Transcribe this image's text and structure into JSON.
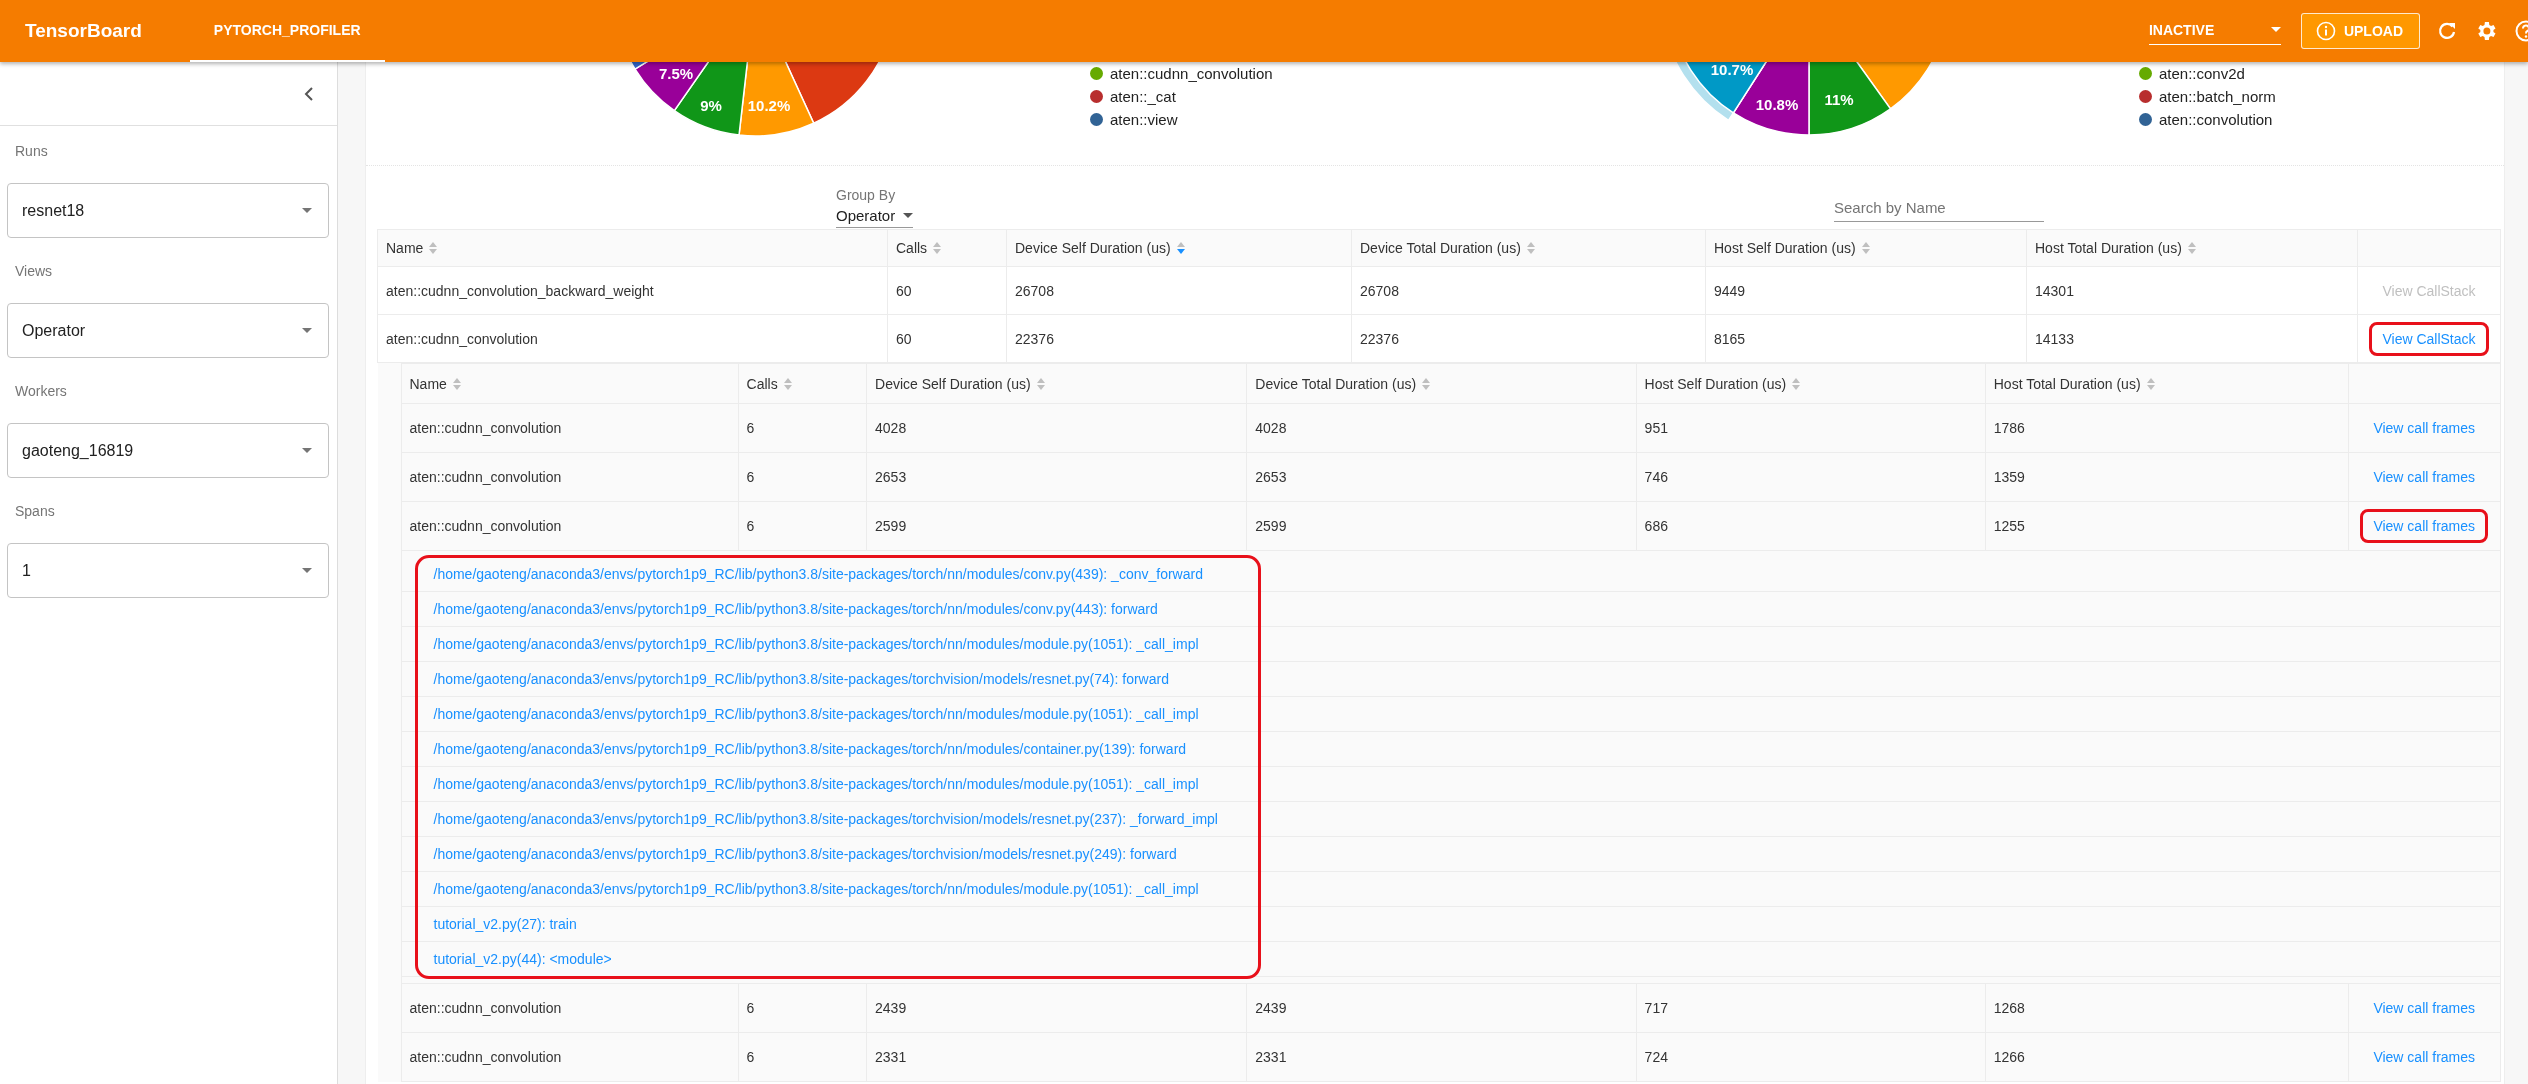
{
  "header": {
    "title": "TensorBoard",
    "tabs": [
      {
        "label": "PYTORCH_PROFILER",
        "selected": true
      }
    ],
    "status_select": {
      "value": "INACTIVE"
    },
    "upload_button": {
      "label": "UPLOAD"
    }
  },
  "sidebar": {
    "fields": [
      {
        "label": "Runs",
        "value": "resnet18"
      },
      {
        "label": "Views",
        "value": "Operator"
      },
      {
        "label": "Workers",
        "value": "gaoteng_16819"
      },
      {
        "label": "Spans",
        "value": "1"
      }
    ]
  },
  "pie_charts": [
    {
      "slices": [
        {
          "label": "7.5%",
          "color": "#990099"
        },
        {
          "label": "9%",
          "color": "#109618"
        },
        {
          "label": "10.2%",
          "color": "#ff9900"
        }
      ],
      "legend": [
        {
          "name": "aten::cudnn_convolution",
          "color": "#66aa00"
        },
        {
          "name": "aten::_cat",
          "color": "#b82e2e"
        },
        {
          "name": "aten::view",
          "color": "#316395"
        }
      ]
    },
    {
      "slices": [
        {
          "label": "10.7%",
          "color": "#0099c6"
        },
        {
          "label": "10.8%",
          "color": "#990099"
        },
        {
          "label": "11%",
          "color": "#109618"
        }
      ],
      "legend": [
        {
          "name": "aten::conv2d",
          "color": "#66aa00"
        },
        {
          "name": "aten::batch_norm",
          "color": "#b82e2e"
        },
        {
          "name": "aten::convolution",
          "color": "#316395"
        }
      ]
    }
  ],
  "group_by": {
    "label": "Group By",
    "value": "Operator"
  },
  "search": {
    "placeholder": "Search by Name"
  },
  "table": {
    "columns": [
      {
        "label": "Name",
        "sorted": false
      },
      {
        "label": "Calls",
        "sorted": false
      },
      {
        "label": "Device Self Duration (us)",
        "sorted": true
      },
      {
        "label": "Device Total Duration (us)",
        "sorted": false
      },
      {
        "label": "Host Self Duration (us)",
        "sorted": false
      },
      {
        "label": "Host Total Duration (us)",
        "sorted": false
      }
    ],
    "rows": [
      {
        "cells": [
          "aten::cudnn_convolution_backward_weight",
          "60",
          "26708",
          "26708",
          "9449",
          "14301"
        ],
        "action": {
          "label": "View CallStack",
          "disabled": true,
          "highlighted": false
        },
        "expanded": false
      },
      {
        "cells": [
          "aten::cudnn_convolution",
          "60",
          "22376",
          "22376",
          "8165",
          "14133"
        ],
        "action": {
          "label": "View CallStack",
          "disabled": false,
          "highlighted": true
        },
        "expanded": true,
        "children": {
          "columns": [
            {
              "label": "Name",
              "sorted": false
            },
            {
              "label": "Calls",
              "sorted": false
            },
            {
              "label": "Device Self Duration (us)",
              "sorted": false
            },
            {
              "label": "Device Total Duration (us)",
              "sorted": false
            },
            {
              "label": "Host Self Duration (us)",
              "sorted": false
            },
            {
              "label": "Host Total Duration (us)",
              "sorted": false
            }
          ],
          "rows": [
            {
              "cells": [
                "aten::cudnn_convolution",
                "6",
                "4028",
                "4028",
                "951",
                "1786"
              ],
              "action": {
                "label": "View call frames",
                "disabled": false,
                "highlighted": false
              },
              "expanded": false
            },
            {
              "cells": [
                "aten::cudnn_convolution",
                "6",
                "2653",
                "2653",
                "746",
                "1359"
              ],
              "action": {
                "label": "View call frames",
                "disabled": false,
                "highlighted": false
              },
              "expanded": false
            },
            {
              "cells": [
                "aten::cudnn_convolution",
                "6",
                "2599",
                "2599",
                "686",
                "1255"
              ],
              "action": {
                "label": "View call frames",
                "disabled": false,
                "highlighted": true
              },
              "expanded": true,
              "frames_highlighted": true,
              "call_frames": [
                "/home/gaoteng/anaconda3/envs/pytorch1p9_RC/lib/python3.8/site-packages/torch/nn/modules/conv.py(439): _conv_forward",
                "/home/gaoteng/anaconda3/envs/pytorch1p9_RC/lib/python3.8/site-packages/torch/nn/modules/conv.py(443): forward",
                "/home/gaoteng/anaconda3/envs/pytorch1p9_RC/lib/python3.8/site-packages/torch/nn/modules/module.py(1051): _call_impl",
                "/home/gaoteng/anaconda3/envs/pytorch1p9_RC/lib/python3.8/site-packages/torchvision/models/resnet.py(74): forward",
                "/home/gaoteng/anaconda3/envs/pytorch1p9_RC/lib/python3.8/site-packages/torch/nn/modules/module.py(1051): _call_impl",
                "/home/gaoteng/anaconda3/envs/pytorch1p9_RC/lib/python3.8/site-packages/torch/nn/modules/container.py(139): forward",
                "/home/gaoteng/anaconda3/envs/pytorch1p9_RC/lib/python3.8/site-packages/torch/nn/modules/module.py(1051): _call_impl",
                "/home/gaoteng/anaconda3/envs/pytorch1p9_RC/lib/python3.8/site-packages/torchvision/models/resnet.py(237): _forward_impl",
                "/home/gaoteng/anaconda3/envs/pytorch1p9_RC/lib/python3.8/site-packages/torchvision/models/resnet.py(249): forward",
                "/home/gaoteng/anaconda3/envs/pytorch1p9_RC/lib/python3.8/site-packages/torch/nn/modules/module.py(1051): _call_impl",
                "tutorial_v2.py(27): train",
                "tutorial_v2.py(44): <module>"
              ]
            },
            {
              "cells": [
                "aten::cudnn_convolution",
                "6",
                "2439",
                "2439",
                "717",
                "1268"
              ],
              "action": {
                "label": "View call frames",
                "disabled": false,
                "highlighted": false
              },
              "expanded": false
            },
            {
              "cells": [
                "aten::cudnn_convolution",
                "6",
                "2331",
                "2331",
                "724",
                "1266"
              ],
              "action": {
                "label": "View call frames",
                "disabled": false,
                "highlighted": false
              },
              "expanded": false
            }
          ]
        }
      }
    ]
  }
}
